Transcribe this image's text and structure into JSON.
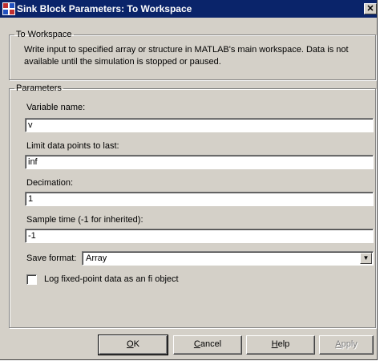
{
  "window": {
    "title": "Sink Block Parameters: To Workspace",
    "close_glyph": "✕"
  },
  "block_info": {
    "group_label": "To Workspace",
    "description": "Write input to specified array or structure in MATLAB's main workspace. Data is not available until the simulation is stopped or paused."
  },
  "parameters": {
    "group_label": "Parameters",
    "variable_name": {
      "label": "Variable name:",
      "value": "v"
    },
    "limit_data_points": {
      "label": "Limit data points to last:",
      "value": "inf"
    },
    "decimation": {
      "label": "Decimation:",
      "value": "1"
    },
    "sample_time": {
      "label": "Sample time (-1 for inherited):",
      "value": "-1"
    },
    "save_format": {
      "label": "Save format:",
      "value": "Array"
    },
    "log_fixed_point": {
      "label": "Log fixed-point data as an fi object",
      "checked": false
    }
  },
  "buttons": {
    "ok": {
      "mnemonic": "O",
      "rest": "K"
    },
    "cancel": {
      "mnemonic": "C",
      "rest": "ancel"
    },
    "help": {
      "mnemonic": "H",
      "rest": "elp"
    },
    "apply": {
      "mnemonic": "A",
      "rest": "pply",
      "enabled": false
    }
  },
  "icons": {
    "app": "simulink-block-icon",
    "dropdown": "chevron-down-icon"
  },
  "colors": {
    "titlebar": "#0a246a",
    "dialog_face": "#d4d0c8"
  }
}
